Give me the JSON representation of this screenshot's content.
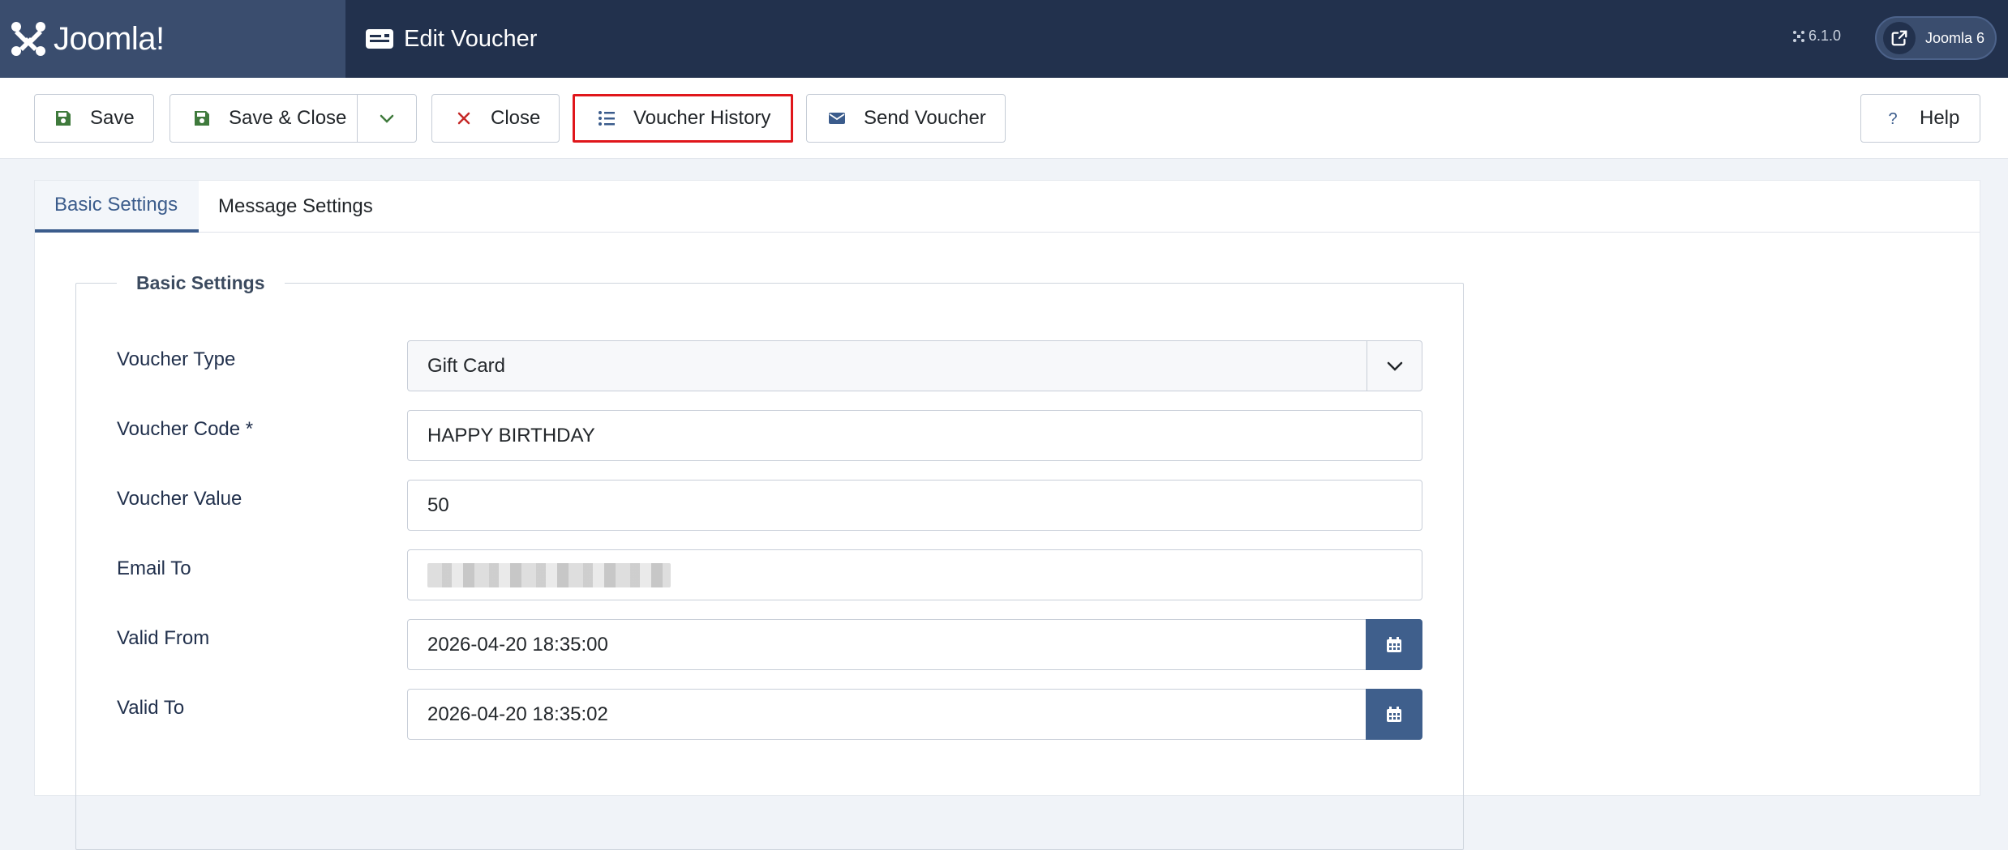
{
  "header": {
    "brand": "Joomla!",
    "page_title": "Edit Voucher",
    "version": "6.1.0",
    "site_name": "Joomla 6"
  },
  "toolbar": {
    "save_label": "Save",
    "save_close_label": "Save & Close",
    "close_label": "Close",
    "voucher_history_label": "Voucher History",
    "send_voucher_label": "Send Voucher",
    "help_label": "Help"
  },
  "tabs": [
    {
      "label": "Basic Settings",
      "active": true
    },
    {
      "label": "Message Settings",
      "active": false
    }
  ],
  "form": {
    "legend": "Basic Settings",
    "voucher_type": {
      "label": "Voucher Type",
      "value": "Gift Card"
    },
    "voucher_code": {
      "label": "Voucher Code *",
      "value": "HAPPY BIRTHDAY"
    },
    "voucher_value": {
      "label": "Voucher Value",
      "value": "50"
    },
    "email_to": {
      "label": "Email To",
      "value": ""
    },
    "valid_from": {
      "label": "Valid From",
      "value": "2026-04-20 18:35:00"
    },
    "valid_to": {
      "label": "Valid To",
      "value": "2026-04-20 18:35:02"
    }
  },
  "colors": {
    "header_bg": "#22314d",
    "brand_bg": "#3a4d6e",
    "accent": "#3b5c8c",
    "highlight_border": "#e0161b",
    "save_icon": "#3f7a3c",
    "close_icon": "#c52827"
  }
}
